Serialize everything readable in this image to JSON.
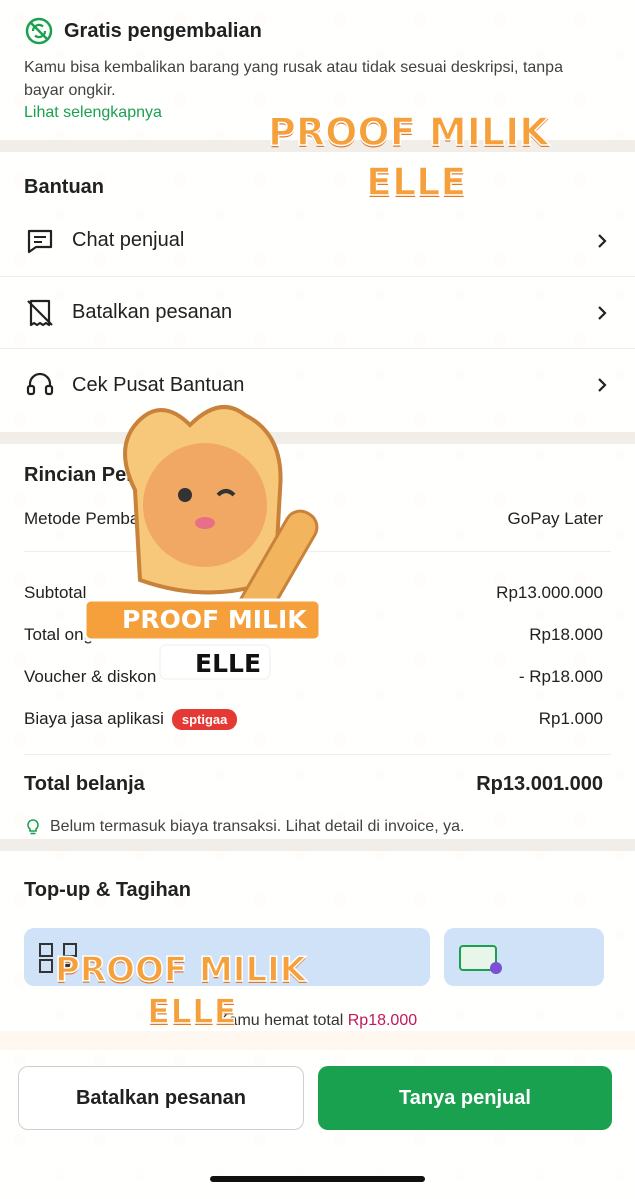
{
  "return_policy": {
    "title": "Gratis pengembalian",
    "description": "Kamu bisa kembalikan barang yang rusak atau tidak sesuai deskripsi, tanpa bayar ongkir.",
    "link": "Lihat selengkapnya"
  },
  "help": {
    "title": "Bantuan",
    "items": [
      {
        "label": "Chat penjual",
        "icon": "chat-icon"
      },
      {
        "label": "Batalkan pesanan",
        "icon": "cancel-receipt-icon"
      },
      {
        "label": "Cek Pusat Bantuan",
        "icon": "headset-icon"
      }
    ]
  },
  "detail": {
    "title": "Rincian Pembayaran",
    "method_label": "Metode Pembayaran",
    "method_value": "GoPay Later",
    "rows": [
      {
        "label": "Subtotal",
        "value": "Rp13.000.000"
      },
      {
        "label": "Total ongkir",
        "value": "Rp18.000"
      },
      {
        "label": "Voucher & diskon",
        "value": "- Rp18.000"
      },
      {
        "label": "Biaya jasa aplikasi",
        "value": "Rp1.000"
      }
    ],
    "badge": "sptigaa",
    "total_label": "Total belanja",
    "total_value": "Rp13.001.000",
    "note": "Belum termasuk biaya transaksi. Lihat detail di invoice, ya."
  },
  "topup": {
    "title": "Top-up & Tagihan"
  },
  "saving": {
    "prefix": "Kamu hemat total",
    "amount": "Rp18.000"
  },
  "actions": {
    "cancel": "Batalkan pesanan",
    "ask": "Tanya penjual"
  },
  "watermark": {
    "line1": "PROOF MILIK",
    "line2": "ELLE"
  },
  "colors": {
    "primary_green": "#1aa14f",
    "badge_red": "#e53935",
    "saving_pink": "#c2185b",
    "watermark_orange": "#f5a03a"
  }
}
